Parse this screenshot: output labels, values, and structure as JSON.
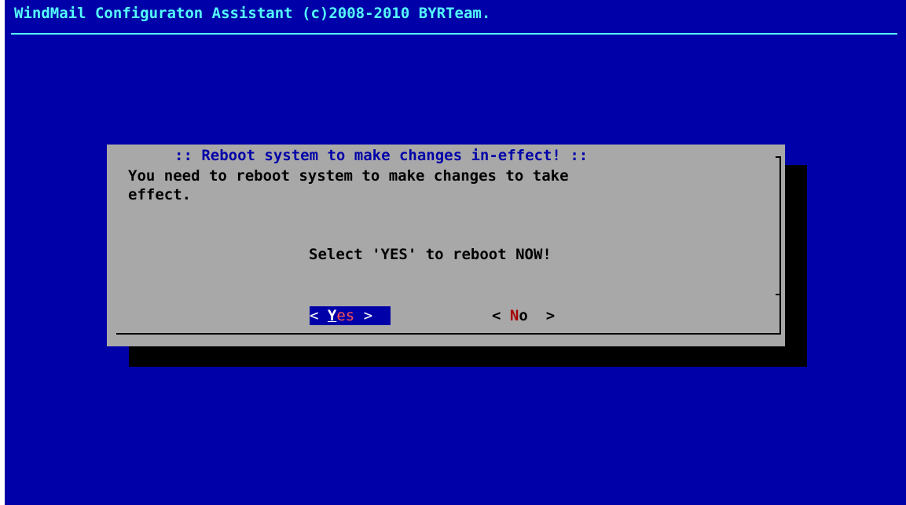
{
  "backtitle": "WindMail Configuraton Assistant (c)2008-2010 BYRTeam.",
  "dialog": {
    "title": ":: Reboot system to make changes in-effect! ::",
    "message_line1": "You need to reboot system to make changes to take",
    "message_line2": "effect.",
    "prompt": "Select 'YES' to reboot NOW!",
    "yes_button": {
      "left_bracket": "<",
      "hotkey": "Y",
      "rest": "es",
      "right_bracket": ">"
    },
    "no_button": {
      "left_bracket": "<",
      "hotkey": "N",
      "rest": "o",
      "right_bracket": ">"
    }
  },
  "colors": {
    "screen_background": "#0000a8",
    "backtitle": "#54fcfc",
    "dialog_background": "#a8a8a8",
    "dialog_title": "#0000a8",
    "shadow": "#000000",
    "selected_button_bg": "#0000a8",
    "hotkey": "#a80000"
  }
}
